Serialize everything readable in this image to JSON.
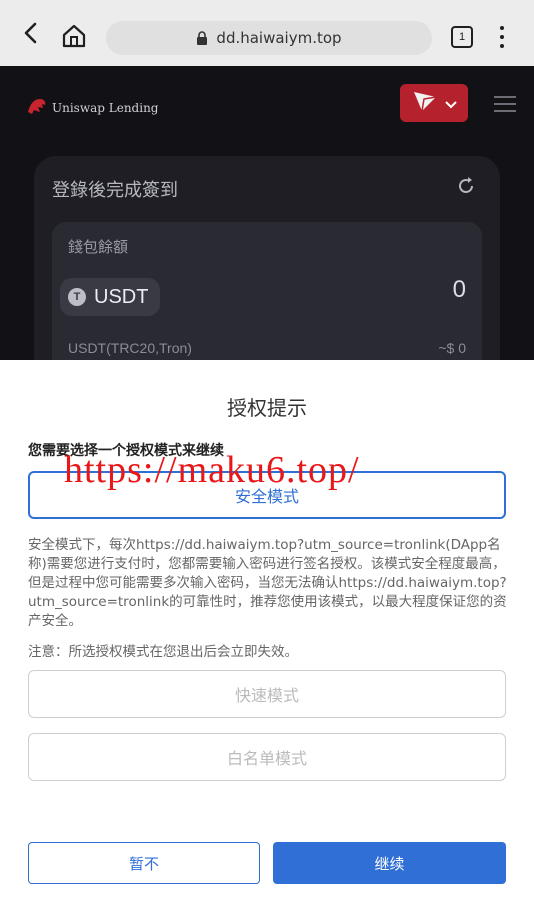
{
  "browser": {
    "url": "dd.haiwaiym.top",
    "tab_count": "1"
  },
  "site": {
    "logo_text": "Uniswap Lending",
    "card_title": "登錄後完成簽到",
    "balance_label": "錢包餘額",
    "token": "USDT",
    "token_symbol": "T",
    "amount": "0",
    "network": "USDT(TRC20,Tron)",
    "usd_value": "~$ 0"
  },
  "modal": {
    "title": "授权提示",
    "prompt": "您需要选择一个授权模式来继续",
    "watermark": "https://maku6.top/",
    "safe_mode": "安全模式",
    "description": "安全模式下，每次https://dd.haiwaiym.top?utm_source=tronlink(DApp名称)需要您进行支付时，您都需要输入密码进行签名授权。该模式安全程度最高，但是过程中您可能需要多次输入密码，当您无法确认https://dd.haiwaiym.top?utm_source=tronlink的可靠性时，推荐您使用该模式，以最大程度保证您的资产安全。",
    "note": "注意：所选授权模式在您退出后会立即失效。",
    "fast_mode": "快速模式",
    "whitelist_mode": "白名单模式",
    "cancel_label": "暂不",
    "continue_label": "继续"
  },
  "colors": {
    "accent": "#2f6fd6",
    "watermark": "#e8171a",
    "lang_button": "#b5222d",
    "page_bg": "#121216"
  },
  "icons": [
    "back-arrow-icon",
    "home-icon",
    "lock-icon",
    "tab-switcher-icon",
    "more-menu-icon",
    "lion-logo-icon",
    "send-icon",
    "chevron-down-icon",
    "hamburger-menu-icon",
    "refresh-icon",
    "tron-coin-icon"
  ]
}
